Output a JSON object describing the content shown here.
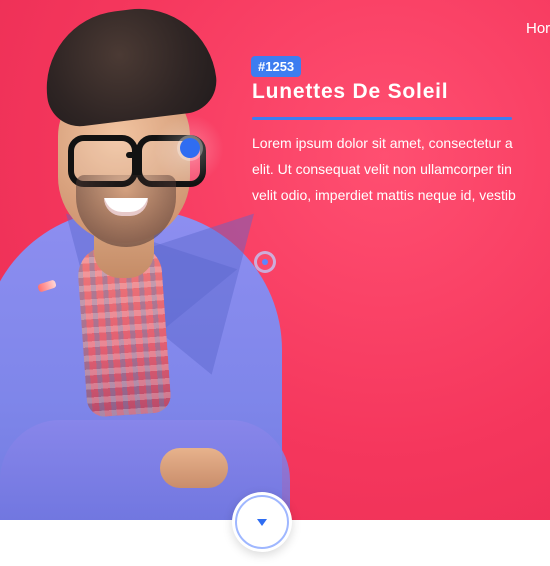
{
  "nav": {
    "home_label": "Hor"
  },
  "product": {
    "id_badge": "#1253",
    "title": "Lunettes De Soleil",
    "description_lines": [
      "Lorem ipsum dolor sit amet, consectetur a",
      "elit. Ut consequat velit non ullamcorper tin",
      "velit odio, imperdiet mattis neque id, vestib"
    ]
  },
  "colors": {
    "hero_bg": "#f5375d",
    "accent": "#3d7df0",
    "text": "#ffffff"
  },
  "icons": {
    "scroll_down": "chevron-down-icon"
  }
}
